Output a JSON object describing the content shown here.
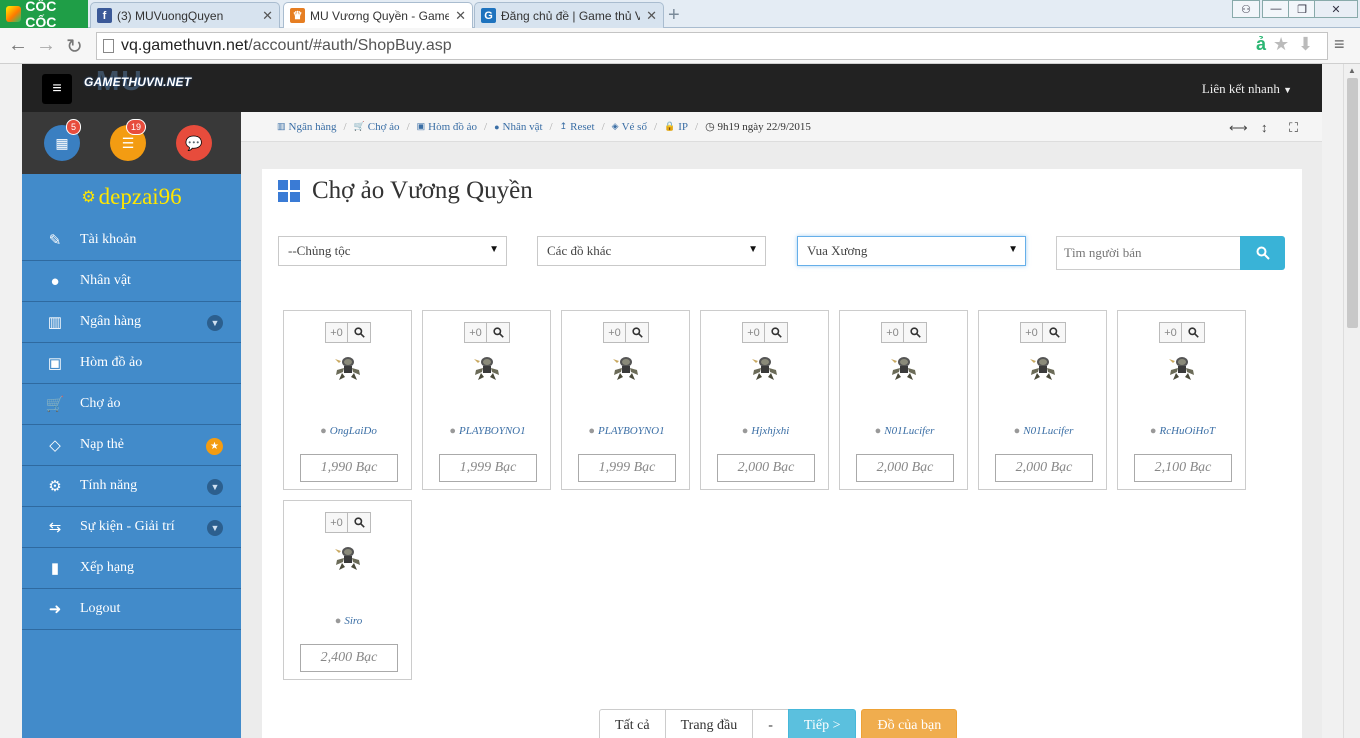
{
  "browser": {
    "brand": "CỐC CỐC",
    "tabs": [
      {
        "title": "(3) MUVuongQuyen",
        "favicon": "facebook-icon",
        "color": "#3b5998",
        "glyph": "f"
      },
      {
        "title": "MU Vương Quyền - GamethuV",
        "favicon": "mu-crown-icon",
        "color": "#e67e22",
        "glyph": "♛"
      },
      {
        "title": "Đăng chủ đề | Game thủ Việt",
        "favicon": "gamethuvn-icon",
        "color": "#1e73be",
        "glyph": "G"
      }
    ],
    "new_tab": "+",
    "url_host": "vq.gamethuvn.net",
    "url_path": "/account/#auth/ShopBuy.asp"
  },
  "site": {
    "logo_text": "GAMETHUVN.NET",
    "logo_mu": "MU",
    "quick_links": "Liên kết nhanh"
  },
  "sidebar": {
    "badges": {
      "calendar": "5",
      "list": "19"
    },
    "username": "depzai96",
    "items": [
      {
        "label": "Tài khoản",
        "icon": "edit-icon",
        "glyph": "✎",
        "name": "sidebar-item-tai-khoan"
      },
      {
        "label": "Nhân vật",
        "icon": "user-icon",
        "glyph": "●",
        "name": "sidebar-item-nhan-vat"
      },
      {
        "label": "Ngân hàng",
        "icon": "bank-icon",
        "glyph": "▥",
        "name": "sidebar-item-ngan-hang",
        "chev": true
      },
      {
        "label": "Hòm đồ ảo",
        "icon": "briefcase-icon",
        "glyph": "▣",
        "name": "sidebar-item-hom-do-ao"
      },
      {
        "label": "Chợ ảo",
        "icon": "cart-icon",
        "glyph": "🛒",
        "name": "sidebar-item-cho-ao"
      },
      {
        "label": "Nạp thẻ",
        "icon": "diamond-icon",
        "glyph": "◇",
        "name": "sidebar-item-nap-the",
        "star": true
      },
      {
        "label": "Tính năng",
        "icon": "cogs-icon",
        "glyph": "⚙",
        "name": "sidebar-item-tinh-nang",
        "chev": true
      },
      {
        "label": "Sự kiện - Giải trí",
        "icon": "exchange-icon",
        "glyph": "⇆",
        "name": "sidebar-item-su-kien",
        "chev": true
      },
      {
        "label": "Xếp hạng",
        "icon": "bar-chart-icon",
        "glyph": "▮",
        "name": "sidebar-item-xep-hang"
      },
      {
        "label": "Logout",
        "icon": "sign-out-icon",
        "glyph": "➜",
        "name": "sidebar-item-logout"
      }
    ]
  },
  "breadcrumb": {
    "items": [
      {
        "label": "Ngân hàng",
        "icon": "bank-icon",
        "glyph": "▥"
      },
      {
        "label": "Chợ ảo",
        "icon": "cart-icon",
        "glyph": "🛒"
      },
      {
        "label": "Hòm đồ ảo",
        "icon": "briefcase-icon",
        "glyph": "▣"
      },
      {
        "label": "Nhân vật",
        "icon": "user-icon",
        "glyph": "●"
      },
      {
        "label": "Reset",
        "icon": "reset-icon",
        "glyph": "↥"
      },
      {
        "label": "Vé số",
        "icon": "ticket-icon",
        "glyph": "◈"
      },
      {
        "label": "IP",
        "icon": "lock-icon",
        "glyph": "🔒"
      }
    ],
    "time": "9h19 ngày 22/9/2015"
  },
  "panel": {
    "title": "Chợ ảo Vương Quyền",
    "filters": {
      "race": "--Chủng tộc",
      "category": "Các đồ khác",
      "item": "Vua Xương"
    },
    "search_placeholder": "Tìm người bán",
    "items": [
      {
        "level": "+0",
        "seller": "OngLaiDo",
        "price": "1,990 Bạc"
      },
      {
        "level": "+0",
        "seller": "PLAYBOYNO1",
        "price": "1,999 Bạc"
      },
      {
        "level": "+0",
        "seller": "PLAYBOYNO1",
        "price": "1,999 Bạc"
      },
      {
        "level": "+0",
        "seller": "Hjxhjxhi",
        "price": "2,000 Bạc"
      },
      {
        "level": "+0",
        "seller": "N01Lucifer",
        "price": "2,000 Bạc"
      },
      {
        "level": "+0",
        "seller": "N01Lucifer",
        "price": "2,000 Bạc"
      },
      {
        "level": "+0",
        "seller": "RcHuOiHoT",
        "price": "2,100 Bạc"
      },
      {
        "level": "+0",
        "seller": "Siro",
        "price": "2,400 Bạc"
      }
    ],
    "pager": {
      "all": "Tất cả",
      "first": "Trang đầu",
      "dash": "-",
      "next": "Tiếp >",
      "mine": "Đồ của bạn"
    }
  }
}
